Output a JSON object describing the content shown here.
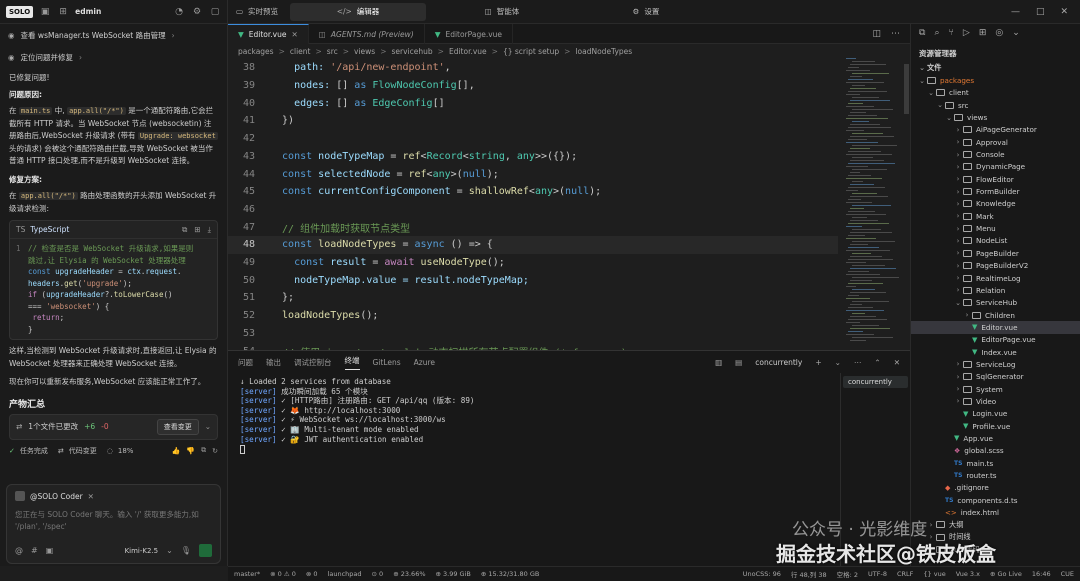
{
  "left": {
    "logo": "SOLO",
    "user": "edmin",
    "task1": "查看 wsManager.ts WebSocket 路由管理",
    "task2": "定位问题并修复",
    "fixed": "已修复问题!",
    "cause_title": "问题原因:",
    "cause_parts": [
      "在 ",
      "main.ts",
      " 中, ",
      "app.all(\"/*\")",
      " 是一个通配符路由,它会拦截所有 HTTP 请求。当 WebSocket 节点 (websocketin) 注册路由后,WebSocket 升级请求 (带有 ",
      "Upgrade: websocket",
      " 头的请求) 会被这个通配符路由拦截,导致 WebSocket 被当作普通 HTTP 接口处理,而不是升级到 WebSocket 连接。"
    ],
    "fix_title": "修复方案:",
    "fix_parts": [
      "在 ",
      "app.all(\"/*\")",
      " 路由处理函数的开头添加 WebSocket 升级请求检测:"
    ],
    "code_lang": "TypeScript",
    "after_text": "这样,当检测到 WebSocket 升级请求时,直接返回,让 Elysia 的 WebSocket 处理器来正确处理 WebSocket 连接。",
    "restart_text": "现在你可以重新发布服务,WebSocket 应该能正常工作了。",
    "summary_title": "产物汇总",
    "file_change": "1个文件已更改",
    "plus": "+6",
    "minus": "-0",
    "view_changes": "查看变更",
    "task_done": "任务完成",
    "code_change": "代码变更",
    "percent": "18%",
    "chat_agent": "@SOLO Coder",
    "chat_placeholder": "您正在与 SOLO Coder 聊天。输入 '/' 获取更多能力,如 '/plan', '/spec'",
    "model": "Kimi-K2.5"
  },
  "top_tabs": [
    "实时预览",
    "编辑器",
    "智能体",
    "设置"
  ],
  "editor": {
    "tabs": [
      "Editor.vue",
      "AGENTS.md (Preview)",
      "EditorPage.vue"
    ],
    "breadcrumb": [
      "packages",
      ">",
      "client",
      ">",
      "src",
      ">",
      "views",
      ">",
      "servicehub",
      ">",
      "Editor.vue",
      ">",
      "{} script setup",
      ">",
      "loadNodeTypes"
    ],
    "lines": [
      {
        "n": "38",
        "cur": false,
        "tokens": [
          [
            "    path: ",
            "v"
          ],
          [
            "'/api/new-endpoint'",
            "s"
          ],
          [
            ",",
            ""
          ]
        ]
      },
      {
        "n": "39",
        "cur": false,
        "tokens": [
          [
            "    nodes: ",
            "v"
          ],
          [
            "[] ",
            ""
          ],
          [
            "as ",
            "k"
          ],
          [
            "FlowNodeConfig",
            "t"
          ],
          [
            "[],",
            ""
          ]
        ]
      },
      {
        "n": "40",
        "cur": false,
        "tokens": [
          [
            "    edges: ",
            "v"
          ],
          [
            "[] ",
            ""
          ],
          [
            "as ",
            "k"
          ],
          [
            "EdgeConfig",
            "t"
          ],
          [
            "[]",
            ""
          ]
        ]
      },
      {
        "n": "41",
        "cur": false,
        "tokens": [
          [
            "  })",
            ""
          ]
        ]
      },
      {
        "n": "42",
        "cur": false,
        "tokens": []
      },
      {
        "n": "43",
        "cur": false,
        "tokens": [
          [
            "  const ",
            "k"
          ],
          [
            "nodeTypeMap",
            "v"
          ],
          [
            " = ",
            ""
          ],
          [
            "ref",
            "f"
          ],
          [
            "<",
            ""
          ],
          [
            "Record",
            "t"
          ],
          [
            "<",
            ""
          ],
          [
            "string",
            "t"
          ],
          [
            ", ",
            ""
          ],
          [
            "any",
            "t"
          ],
          [
            ">>",
            ""
          ],
          [
            "({})",
            ""
          ],
          [
            ";",
            ""
          ]
        ]
      },
      {
        "n": "44",
        "cur": false,
        "tokens": [
          [
            "  const ",
            "k"
          ],
          [
            "selectedNode",
            "v"
          ],
          [
            " = ",
            ""
          ],
          [
            "ref",
            "f"
          ],
          [
            "<",
            ""
          ],
          [
            "any",
            "t"
          ],
          [
            ">(",
            ""
          ],
          [
            "null",
            "k"
          ],
          [
            ");",
            ""
          ]
        ]
      },
      {
        "n": "45",
        "cur": false,
        "tokens": [
          [
            "  const ",
            "k"
          ],
          [
            "currentConfigComponent",
            "v"
          ],
          [
            " = ",
            ""
          ],
          [
            "shallowRef",
            "f"
          ],
          [
            "<",
            ""
          ],
          [
            "any",
            "t"
          ],
          [
            ">(",
            ""
          ],
          [
            "null",
            "k"
          ],
          [
            ");",
            ""
          ]
        ]
      },
      {
        "n": "46",
        "cur": false,
        "tokens": []
      },
      {
        "n": "47",
        "cur": false,
        "tokens": [
          [
            "  // 组件加载时获取节点类型",
            "c"
          ]
        ]
      },
      {
        "n": "48",
        "cur": true,
        "tokens": [
          [
            "  const ",
            "k"
          ],
          [
            "loadNodeTypes",
            "f"
          ],
          [
            " = ",
            ""
          ],
          [
            "async ",
            "k"
          ],
          [
            "() => {",
            ""
          ]
        ]
      },
      {
        "n": "49",
        "cur": false,
        "tokens": [
          [
            "    const ",
            "k"
          ],
          [
            "result",
            "v"
          ],
          [
            " = ",
            ""
          ],
          [
            "await ",
            "pu"
          ],
          [
            "useNodeType",
            "f"
          ],
          [
            "();",
            ""
          ]
        ]
      },
      {
        "n": "50",
        "cur": false,
        "tokens": [
          [
            "    nodeTypeMap",
            "v"
          ],
          [
            ".value = ",
            "v"
          ],
          [
            "result",
            "v"
          ],
          [
            ".nodeTypeMap;",
            "v"
          ]
        ]
      },
      {
        "n": "51",
        "cur": false,
        "tokens": [
          [
            "  };",
            ""
          ]
        ]
      },
      {
        "n": "52",
        "cur": false,
        "tokens": [
          [
            "  loadNodeTypes",
            "f"
          ],
          [
            "();",
            ""
          ]
        ]
      },
      {
        "n": "53",
        "cur": false,
        "tokens": []
      },
      {
        "n": "54",
        "cur": false,
        "tokens": [
          [
            "  // 使用 import.meta.glob 动态扫描所有节点配置组件 (*.form.vue)",
            "c"
          ]
        ]
      }
    ]
  },
  "panel": {
    "tabs": [
      "问题",
      "输出",
      "调试控制台",
      "终端",
      "GitLens",
      "Azure"
    ],
    "terminal_name": "concurrently",
    "term_lines": [
      {
        "tag": "",
        "text": "↓ Loaded 2 services from database"
      },
      {
        "tag": "[server]",
        "text": "成功瞬间加载 65 个模块"
      },
      {
        "tag": "[server]",
        "text": "✓ [HTTP路由] 注册路由: GET /api/qq (版本: 89)"
      },
      {
        "tag": "[server]",
        "text": "✓ 🦊 http://localhost:3000"
      },
      {
        "tag": "[server]",
        "text": "✓ ⚡ WebSocket ws://localhost:3000/ws"
      },
      {
        "tag": "[server]",
        "text": "✓ 🏢 Multi-tenant mode enabled"
      },
      {
        "tag": "[server]",
        "text": "✓ 🔐 JWT authentication enabled"
      }
    ]
  },
  "explorer": {
    "title": "资源管理器",
    "section": "文件",
    "items": [
      {
        "d": 0,
        "t": "folder",
        "name": "packages",
        "open": true,
        "color": "#e37933"
      },
      {
        "d": 1,
        "t": "folder",
        "name": "client",
        "open": true
      },
      {
        "d": 2,
        "t": "folder",
        "name": "src",
        "open": true
      },
      {
        "d": 3,
        "t": "folder",
        "name": "views",
        "open": true
      },
      {
        "d": 4,
        "t": "folder",
        "name": "AiPageGenerator"
      },
      {
        "d": 4,
        "t": "folder",
        "name": "Approval"
      },
      {
        "d": 4,
        "t": "folder",
        "name": "Console"
      },
      {
        "d": 4,
        "t": "folder",
        "name": "DynamicPage"
      },
      {
        "d": 4,
        "t": "folder",
        "name": "FlowEditor"
      },
      {
        "d": 4,
        "t": "folder",
        "name": "FormBuilder"
      },
      {
        "d": 4,
        "t": "folder",
        "name": "Knowledge"
      },
      {
        "d": 4,
        "t": "folder",
        "name": "Mark"
      },
      {
        "d": 4,
        "t": "folder",
        "name": "Menu"
      },
      {
        "d": 4,
        "t": "folder",
        "name": "NodeList"
      },
      {
        "d": 4,
        "t": "folder",
        "name": "PageBuilder"
      },
      {
        "d": 4,
        "t": "folder",
        "name": "PageBuilderV2"
      },
      {
        "d": 4,
        "t": "folder",
        "name": "RealtimeLog"
      },
      {
        "d": 4,
        "t": "folder",
        "name": "Relation"
      },
      {
        "d": 4,
        "t": "folder",
        "name": "ServiceHub",
        "open": true
      },
      {
        "d": 5,
        "t": "folder",
        "name": "Children"
      },
      {
        "d": 5,
        "t": "vue",
        "name": "Editor.vue",
        "sel": true
      },
      {
        "d": 5,
        "t": "vue",
        "name": "EditorPage.vue"
      },
      {
        "d": 5,
        "t": "vue",
        "name": "Index.vue"
      },
      {
        "d": 4,
        "t": "folder",
        "name": "ServiceLog"
      },
      {
        "d": 4,
        "t": "folder",
        "name": "SqlGenerator"
      },
      {
        "d": 4,
        "t": "folder",
        "name": "System"
      },
      {
        "d": 4,
        "t": "folder",
        "name": "Video"
      },
      {
        "d": 4,
        "t": "vue",
        "name": "Login.vue"
      },
      {
        "d": 4,
        "t": "vue",
        "name": "Profile.vue"
      },
      {
        "d": 3,
        "t": "vue",
        "name": "App.vue"
      },
      {
        "d": 3,
        "t": "scss",
        "name": "global.scss"
      },
      {
        "d": 3,
        "t": "ts",
        "name": "main.ts"
      },
      {
        "d": 3,
        "t": "ts",
        "name": "router.ts"
      },
      {
        "d": 2,
        "t": "git",
        "name": ".gitignore"
      },
      {
        "d": 2,
        "t": "ts",
        "name": "components.d.ts"
      },
      {
        "d": 2,
        "t": "html",
        "name": "index.html"
      },
      {
        "d": 1,
        "t": "folder",
        "name": "大纲"
      },
      {
        "d": 1,
        "t": "folder",
        "name": "时间线"
      },
      {
        "d": 1,
        "t": "folder",
        "name": "Cue 代码"
      }
    ]
  },
  "status": {
    "left": [
      "master*",
      "⊗ 0 ⚠ 0",
      "⊗ 0",
      "launchpad",
      "⊙ 0",
      "⊕ 23.66%",
      "⊕ 3.99 GiB",
      "⊕ 15.32/31.80 GB"
    ],
    "right": [
      "UnoCSS: 96",
      "行 48,列 38",
      "空格: 2",
      "UTF-8",
      "CRLF",
      "{} vue",
      "Vue 3.x",
      "⊕ Go Live",
      "16:46",
      "CUE"
    ]
  },
  "watermark": "掘金技术社区@铁皮饭盒",
  "watermark2": "公众号 · 光影维度"
}
